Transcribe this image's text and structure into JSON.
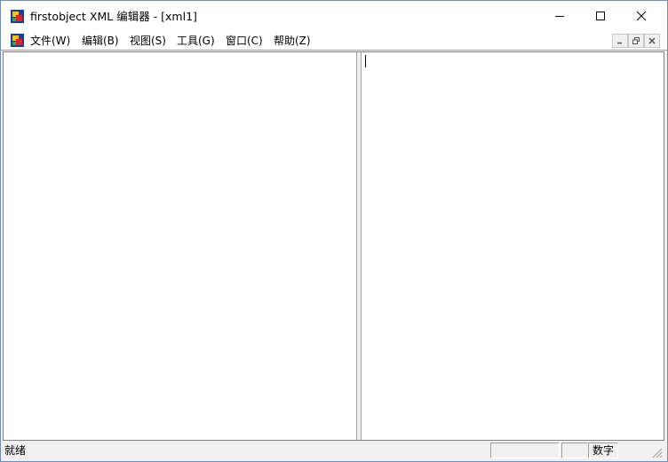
{
  "window": {
    "title": "firstobject XML 编辑器 - [xml1]"
  },
  "menubar": {
    "items": [
      "文件(W)",
      "编辑(B)",
      "视图(S)",
      "工具(G)",
      "窗口(C)",
      "帮助(Z)"
    ]
  },
  "statusbar": {
    "text": "就绪",
    "panels": [
      "",
      "",
      "数字"
    ]
  },
  "icons": {
    "app": "app-logo-icon",
    "doc": "document-logo-icon",
    "minimize": "minimize-icon",
    "maximize": "maximize-icon",
    "close": "close-icon",
    "mdi_minimize": "mdi-minimize-icon",
    "mdi_restore": "mdi-restore-icon",
    "mdi_close": "mdi-close-icon",
    "grip": "resize-grip-icon"
  }
}
